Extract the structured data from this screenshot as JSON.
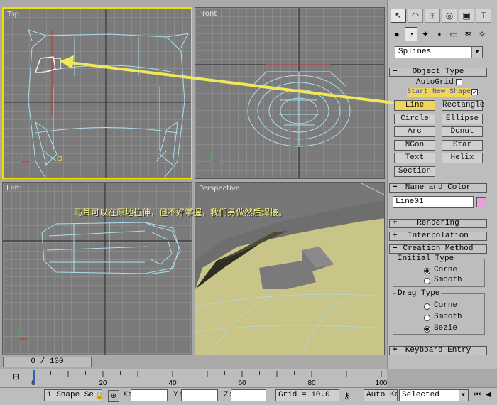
{
  "viewports": {
    "top": {
      "label": "Top"
    },
    "front": {
      "label": "Front"
    },
    "left": {
      "label": "Left"
    },
    "perspective": {
      "label": "Perspective"
    }
  },
  "annotation": "马耳可以在原地拉伸，但不好掌握，我们另做然后焊接。",
  "command_panel": {
    "category_dropdown": "Splines",
    "object_type": {
      "title": "Object Type",
      "autogrid_label": "AutoGrid",
      "start_new_shape_label": "Start New Shape",
      "buttons": [
        "Line",
        "Rectangle",
        "Circle",
        "Ellipse",
        "Arc",
        "Donut",
        "NGon",
        "Star",
        "Text",
        "Helix",
        "Section"
      ],
      "active_button": "Line"
    },
    "name_and_color": {
      "title": "Name and Color",
      "name_value": "Line01",
      "color": "#e8a0d8"
    },
    "rollouts": {
      "rendering": "Rendering",
      "interpolation": "Interpolation",
      "creation_method": "Creation Method",
      "keyboard_entry": "Keyboard Entry"
    },
    "initial_type": {
      "title": "Initial Type",
      "options": [
        "Corne",
        "Smooth"
      ],
      "selected": "Corne"
    },
    "drag_type": {
      "title": "Drag Type",
      "options": [
        "Corne",
        "Smooth",
        "Bezie"
      ],
      "selected": "Bezie"
    }
  },
  "timeline": {
    "frame_counter": "0 / 100",
    "ticks": [
      "0",
      "20",
      "40",
      "60",
      "80",
      "100"
    ]
  },
  "status_bar": {
    "selection": "1 Shape Se",
    "x_label": "X:",
    "y_label": "Y:",
    "z_label": "Z:",
    "grid": "Grid = 10.0",
    "auto_key": "Auto Key",
    "selected_dropdown": "Selected"
  },
  "colors": {
    "active_viewport_border": "#f2e000",
    "wireframe": "#a8e0f0",
    "surface": "#c9c488",
    "highlight_button": "#f2d45a"
  }
}
